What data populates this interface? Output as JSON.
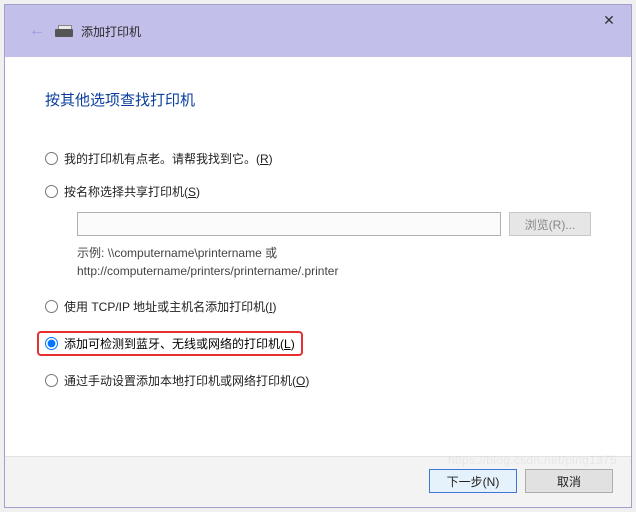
{
  "titlebar": {
    "title": "添加打印机"
  },
  "heading": "按其他选项查找打印机",
  "options": {
    "older": {
      "label": "我的打印机有点老。请帮我找到它。(",
      "hk": "R",
      "suffix": ")"
    },
    "shared": {
      "label": "按名称选择共享打印机(",
      "hk": "S",
      "suffix": ")"
    },
    "tcpip": {
      "label": "使用 TCP/IP 地址或主机名添加打印机(",
      "hk": "I",
      "suffix": ")"
    },
    "wireless": {
      "label": "添加可检测到蓝牙、无线或网络的打印机(",
      "hk": "L",
      "suffix": ")"
    },
    "local": {
      "label": "通过手动设置添加本地打印机或网络打印机(",
      "hk": "O",
      "suffix": ")"
    }
  },
  "shared_block": {
    "browse_label": "浏览(R)...",
    "example_label": "示例:",
    "example_line1": "\\\\computername\\printername 或",
    "example_line2": "http://computername/printers/printername/.printer"
  },
  "share_input_value": "",
  "footer": {
    "next": "下一步(N)",
    "cancel": "取消"
  },
  "watermark": "https://blog.csdn.net/ping1375"
}
